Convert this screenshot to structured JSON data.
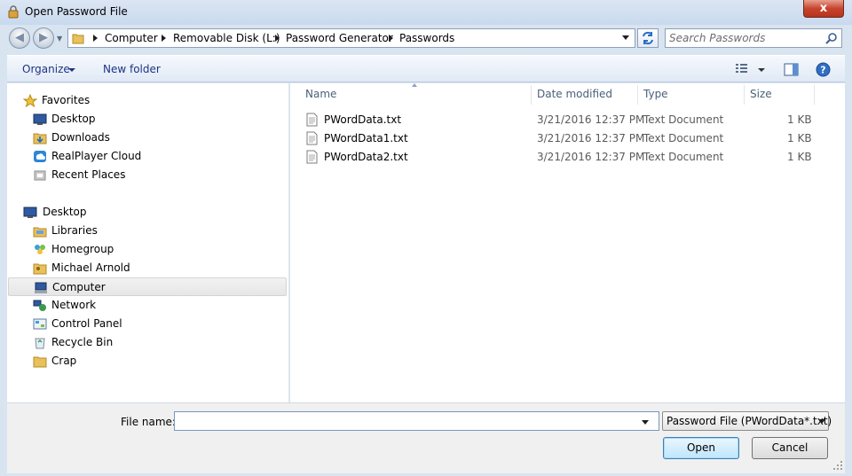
{
  "window": {
    "title": "Open Password File",
    "close_label": "x"
  },
  "address": {
    "crumbs": [
      "Computer",
      "Removable Disk (L:)",
      "Password Generator",
      "Passwords"
    ],
    "search_placeholder": "Search Passwords"
  },
  "toolbar": {
    "organize_label": "Organize",
    "new_folder_label": "New folder"
  },
  "nav": {
    "favorites": [
      "Favorites",
      "Desktop",
      "Downloads",
      "RealPlayer Cloud",
      "Recent Places"
    ],
    "tree": [
      "Desktop",
      "Libraries",
      "Homegroup",
      "Michael Arnold",
      "Computer",
      "Network",
      "Control Panel",
      "Recycle Bin",
      "Crap"
    ],
    "selected": "Computer"
  },
  "columns": [
    "Name",
    "Date modified",
    "Type",
    "Size"
  ],
  "files": [
    {
      "name": "PWordData.txt",
      "date": "3/21/2016 12:37 PM",
      "type": "Text Document",
      "size": "1 KB"
    },
    {
      "name": "PWordData1.txt",
      "date": "3/21/2016 12:37 PM",
      "type": "Text Document",
      "size": "1 KB"
    },
    {
      "name": "PWordData2.txt",
      "date": "3/21/2016 12:37 PM",
      "type": "Text Document",
      "size": "1 KB"
    }
  ],
  "bottom": {
    "file_name_label": "File name:",
    "file_name_value": "",
    "filter_label": "Password File (PWordData*.txt)",
    "open_label": "Open",
    "cancel_label": "Cancel"
  },
  "colors": {
    "accent": "#1e3287",
    "window_bg": "#d9e4f1",
    "header_text": "#4c607a",
    "meta_text": "#5a5a5a"
  },
  "icons": {
    "title": "lock-file-icon",
    "back": "back-arrow-icon",
    "forward": "forward-arrow-icon",
    "refresh": "refresh-icon",
    "search": "search-icon",
    "views": "view-options-icon",
    "preview": "preview-pane-icon",
    "help": "help-icon"
  }
}
